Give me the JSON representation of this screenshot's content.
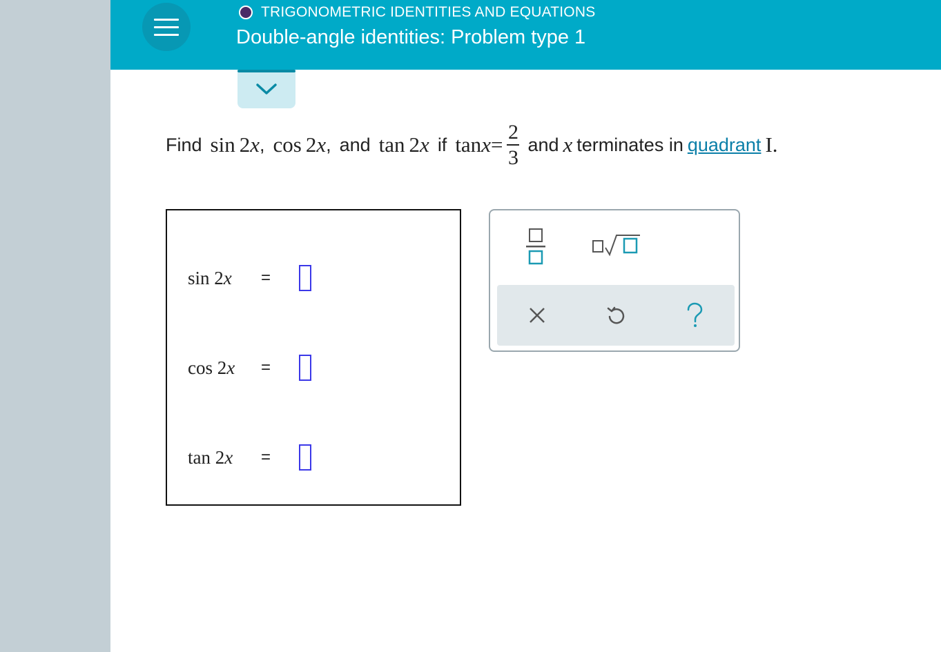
{
  "header": {
    "topic": "TRIGONOMETRIC IDENTITIES AND EQUATIONS",
    "title": "Double-angle identities: Problem type 1"
  },
  "question": {
    "find": "Find",
    "sin_fn": "sin",
    "cos_fn": "cos",
    "tan_fn": "tan",
    "two": "2",
    "var": "x",
    "comma": ",",
    "and": "and",
    "if": "if",
    "equals": "=",
    "numerator": "2",
    "denominator": "3",
    "terminates_text": "terminates in",
    "quadrant_link": "quadrant",
    "quadrant_value": "I."
  },
  "answers": [
    {
      "fn": "sin",
      "arg": "2",
      "var": "x",
      "eq": "="
    },
    {
      "fn": "cos",
      "arg": "2",
      "var": "x",
      "eq": "="
    },
    {
      "fn": "tan",
      "arg": "2",
      "var": "x",
      "eq": "="
    }
  ],
  "palette": {
    "tools": [
      "fraction-icon",
      "nth-root-icon"
    ],
    "actions": [
      "clear-icon",
      "undo-icon",
      "help-icon"
    ]
  },
  "colors": {
    "header": "#00aac8",
    "left_rail": "#c3cfd5",
    "answer_slot": "#3b38e8",
    "link": "#0b7fa8",
    "icon": "#1b9ab3"
  }
}
